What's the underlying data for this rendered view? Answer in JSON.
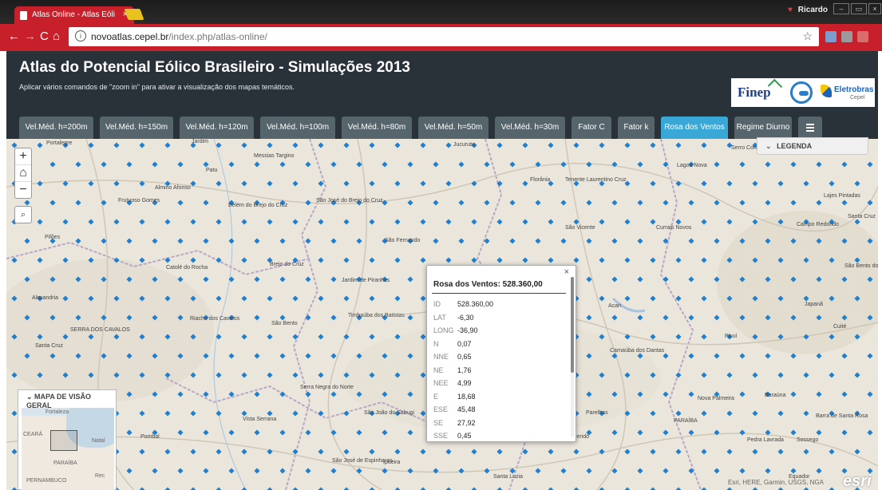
{
  "browser": {
    "tab_title": "Atlas Online - Atlas Eóli",
    "tab_close": "×",
    "profile_name": "Ricardo",
    "url_host": "novoatlas.cepel.br",
    "url_path": "/index.php/atlas-online/",
    "icons": [
      "back-icon",
      "forward-icon",
      "reload-icon",
      "home-icon",
      "info-icon",
      "star-icon"
    ]
  },
  "header": {
    "title": "Atlas do Potencial Eólico Brasileiro - Simulações 2013",
    "subtitle": "Aplicar vários comandos de \"zoom in\" para ativar a visualização dos mapas temáticos.",
    "logos": {
      "finep": "Finep",
      "eletrobras": "Eletrobras",
      "eletrobras_sub": "Cepel"
    }
  },
  "tabs": [
    {
      "label": "Vel.Méd. h=200m",
      "active": false
    },
    {
      "label": "Vel.Méd. h=150m",
      "active": false
    },
    {
      "label": "Vel.Méd. h=120m",
      "active": false
    },
    {
      "label": "Vel.Méd. h=100m",
      "active": false
    },
    {
      "label": "Vel.Méd. h=80m",
      "active": false
    },
    {
      "label": "Vel.Méd. h=50m",
      "active": false
    },
    {
      "label": "Vel.Méd. h=30m",
      "active": false
    },
    {
      "label": "Fator C",
      "active": false
    },
    {
      "label": "Fator k",
      "active": false
    },
    {
      "label": "Rosa dos Ventos",
      "active": true
    },
    {
      "label": "Regime Diurno",
      "active": false
    }
  ],
  "map": {
    "zoom_in": "+",
    "home": "⌂",
    "zoom_out": "−",
    "search": "🔍",
    "legend_label": "LEGENDA",
    "overview_label": "MAPA DE VISÃO GERAL",
    "overview_places": [
      "Fortaleza",
      "CEARÁ",
      "Natal",
      "PARAÍBA",
      "PERNAMBUCO",
      "Rec"
    ],
    "attribution": "Esri, HERE, Garmin, USGS, NGA",
    "esri_logo": "esri",
    "place_labels": [
      "Portalegre",
      "Jardim",
      "Messias Targino",
      "Jucurutu",
      "Lagoa Nova",
      "Serro Cora",
      "Patu",
      "Almino Afonso",
      "Frutuoso Gomes",
      "Belém do Brejo do Cruz",
      "São José do Brejo do Cruz",
      "Florânia",
      "Tenente Laurentino Cruz",
      "Lajes Pintadas",
      "Santa Cruz",
      "Pilões",
      "São Fernando",
      "São Vicente",
      "Currais Novos",
      "Campo Redondo",
      "Catolé do Rocha",
      "Brejo do Cruz",
      "Jardim de Piranhas",
      "Alexandria",
      "Timbaúba dos Batistas",
      "Acari",
      "São Bento do Trairi",
      "Japanã",
      "Riacho dos Cavalos",
      "São Bento",
      "Cuité",
      "Santa Cruz",
      "Picuí",
      "Carnaúba dos Dantas",
      "Serra Negra do Norte",
      "Nova Palmeira",
      "Baraúna",
      "Vista Serrana",
      "São João do Sabugi",
      "Parelhas",
      "Barra de Santa Rosa",
      "Pombal",
      "Ipueira",
      "Santana do Seridó",
      "Pedra Lavrada",
      "Sossego",
      "São José de Espinharas",
      "Santa Luzia",
      "Equador",
      "PARAÍBA",
      "SERRA DOS CAVALOS"
    ]
  },
  "popup": {
    "title": "Rosa dos Ventos: 528.360,00",
    "close": "×",
    "rows": [
      {
        "key": "ID",
        "value": "528.360,00"
      },
      {
        "key": "LAT",
        "value": "-6,30"
      },
      {
        "key": "LONG",
        "value": "-36,90"
      },
      {
        "key": "N",
        "value": "0,07"
      },
      {
        "key": "NNE",
        "value": "0,65"
      },
      {
        "key": "NE",
        "value": "1,76"
      },
      {
        "key": "NEE",
        "value": "4,99"
      },
      {
        "key": "E",
        "value": "18,68"
      },
      {
        "key": "ESE",
        "value": "45,48"
      },
      {
        "key": "SE",
        "value": "27,92"
      },
      {
        "key": "SSE",
        "value": "0,45"
      }
    ]
  },
  "colors": {
    "browser_accent": "#c8202b",
    "header_bg": "#283238",
    "tab_bg": "#56646c",
    "tab_active": "#39a8d6",
    "map_marker": "#1f7fd0"
  }
}
